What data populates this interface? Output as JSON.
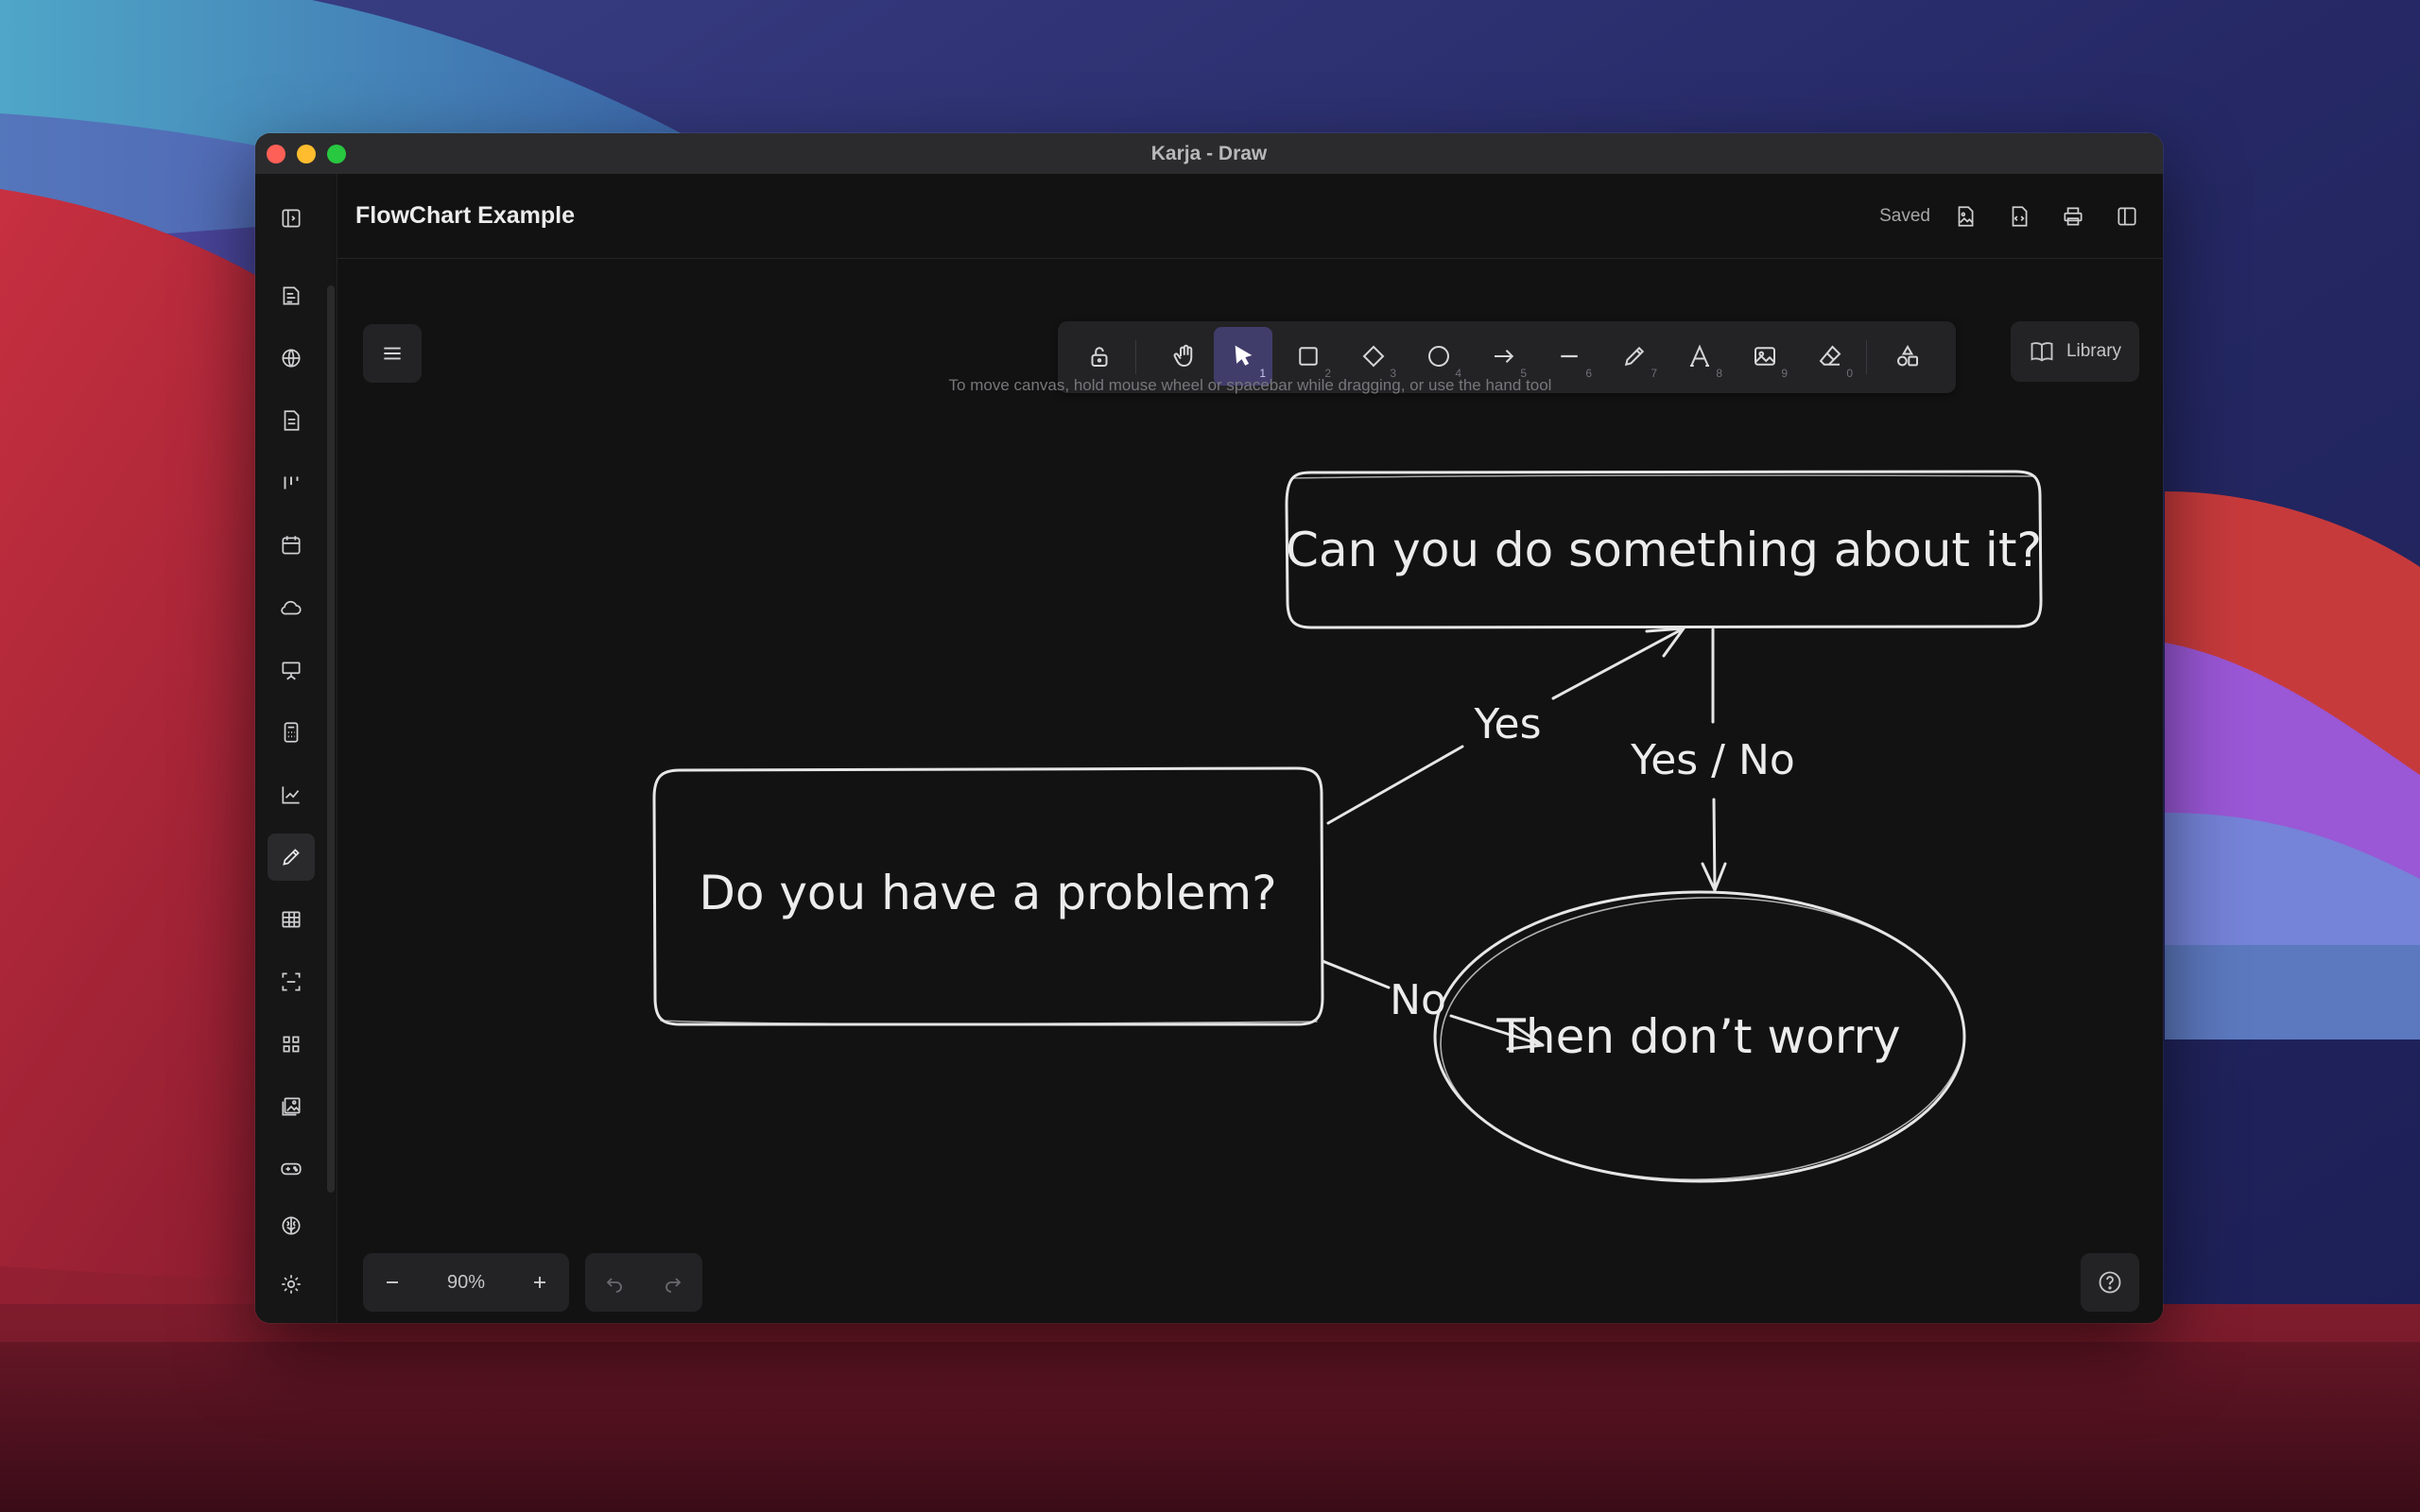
{
  "window": {
    "title": "Karja - Draw"
  },
  "sidebar": {
    "items": [
      {
        "icon": "panel-toggle-icon"
      },
      {
        "icon": "notes-icon"
      },
      {
        "icon": "globe-icon"
      },
      {
        "icon": "document-icon"
      },
      {
        "icon": "kanban-icon"
      },
      {
        "icon": "calendar-icon"
      },
      {
        "icon": "cloud-icon"
      },
      {
        "icon": "presentation-icon"
      },
      {
        "icon": "calculator-icon"
      },
      {
        "icon": "chart-icon"
      },
      {
        "icon": "pencil-icon",
        "active": true
      },
      {
        "icon": "table-icon"
      },
      {
        "icon": "scan-icon"
      },
      {
        "icon": "apps-grid-icon"
      },
      {
        "icon": "image-gallery-icon"
      },
      {
        "icon": "gamepad-icon"
      },
      {
        "icon": "brain-icon"
      },
      {
        "icon": "settings-icon"
      }
    ]
  },
  "header": {
    "doc_title": "FlowChart Example",
    "status": "Saved",
    "actions": [
      "export-image-icon",
      "export-code-icon",
      "print-icon",
      "sidebar-panel-icon"
    ]
  },
  "toolbar": {
    "tools": [
      {
        "name": "lock",
        "icon": "lock-open-icon",
        "key": ""
      },
      {
        "name": "hand",
        "icon": "hand-icon",
        "key": ""
      },
      {
        "name": "selection",
        "icon": "cursor-icon",
        "key": "1",
        "active": true
      },
      {
        "name": "rectangle",
        "icon": "rectangle-icon",
        "key": "2"
      },
      {
        "name": "diamond",
        "icon": "diamond-icon",
        "key": "3"
      },
      {
        "name": "ellipse",
        "icon": "ellipse-icon",
        "key": "4"
      },
      {
        "name": "arrow",
        "icon": "arrow-icon",
        "key": "5"
      },
      {
        "name": "line",
        "icon": "line-icon",
        "key": "6"
      },
      {
        "name": "draw",
        "icon": "pencil-icon",
        "key": "7"
      },
      {
        "name": "text",
        "icon": "text-icon",
        "key": "8"
      },
      {
        "name": "image",
        "icon": "image-icon",
        "key": "9"
      },
      {
        "name": "eraser",
        "icon": "eraser-icon",
        "key": "0"
      },
      {
        "name": "more-shapes",
        "icon": "shapes-icon",
        "key": ""
      }
    ]
  },
  "library": {
    "label": "Library"
  },
  "hint": "To move canvas, hold mouse wheel or spacebar while dragging, or use the hand tool",
  "diagram": {
    "nodes": {
      "start": "Do you have a problem?",
      "question": "Can you do something about it?",
      "end": "Then don’t worry"
    },
    "edges": {
      "yes": "Yes",
      "no": "No",
      "yes_no": "Yes / No"
    }
  },
  "zoom": {
    "level": "90%"
  },
  "colors": {
    "accent": "#413d6b",
    "canvas": "#121212",
    "stroke": "#ececec"
  }
}
